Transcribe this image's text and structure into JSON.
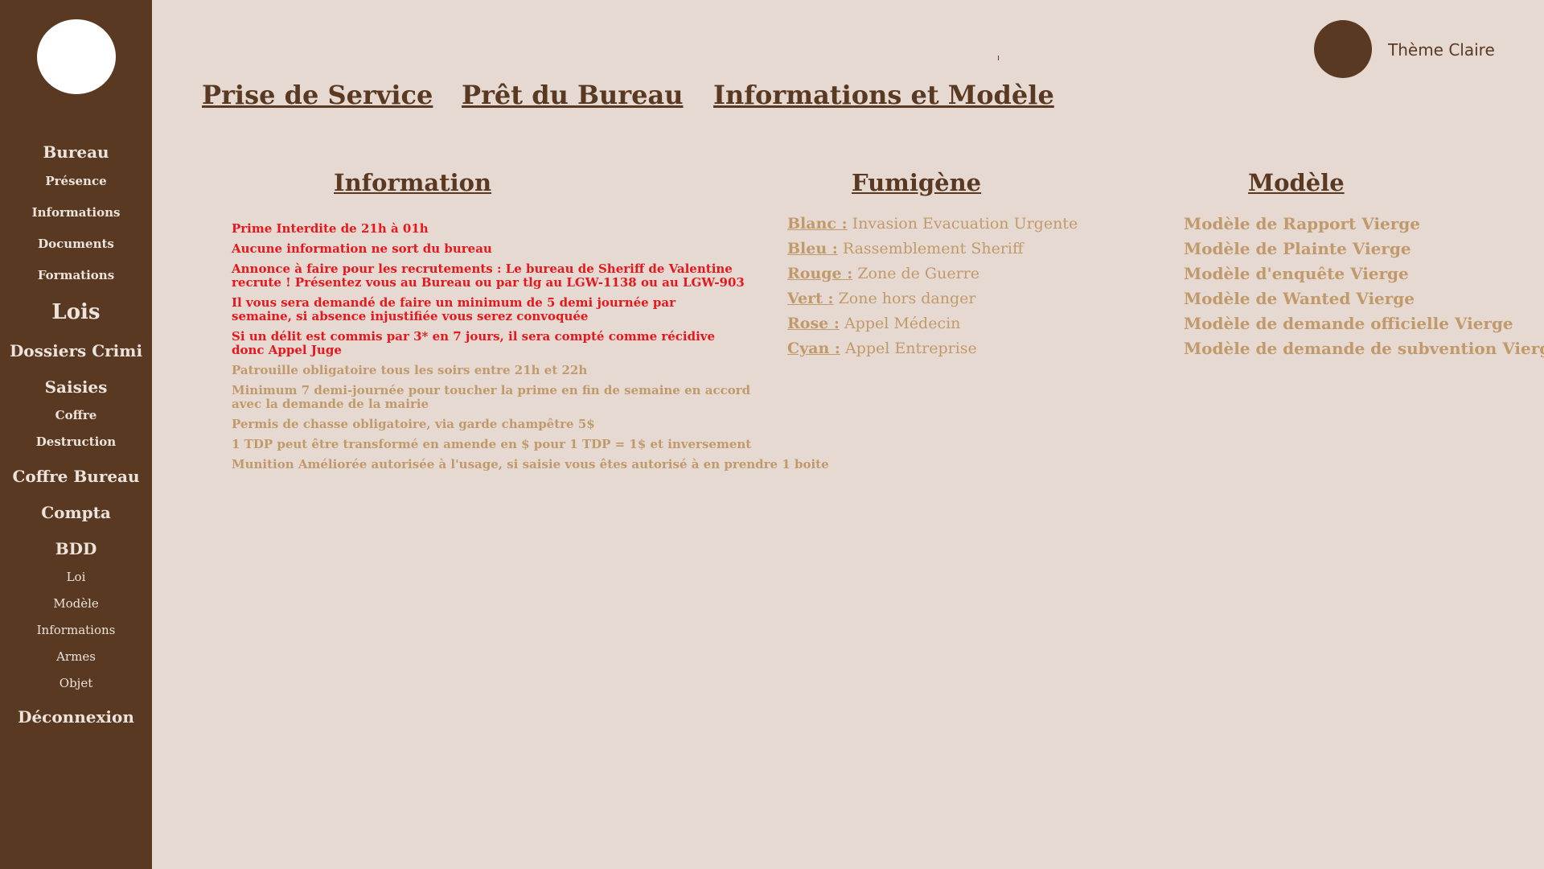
{
  "sidebar": {
    "items": [
      {
        "label": "Bureau"
      },
      {
        "label": "Présence"
      },
      {
        "label": "Informations"
      },
      {
        "label": "Documents"
      },
      {
        "label": "Formations"
      },
      {
        "label": "Lois"
      },
      {
        "label": "Dossiers Crimi"
      },
      {
        "label": "Saisies"
      },
      {
        "label": "Coffre"
      },
      {
        "label": "Destruction"
      },
      {
        "label": "Coffre Bureau"
      },
      {
        "label": "Compta"
      },
      {
        "label": "BDD"
      },
      {
        "label": "Loi"
      },
      {
        "label": "Modèle"
      },
      {
        "label": "Informations"
      },
      {
        "label": "Armes"
      },
      {
        "label": "Objet"
      },
      {
        "label": "Déconnexion"
      }
    ]
  },
  "header": {
    "theme_label": "Thème Claire",
    "tabs": [
      {
        "label": "Prise de Service"
      },
      {
        "label": "Prêt du Bureau"
      },
      {
        "label": "Informations et Modèle"
      }
    ]
  },
  "information": {
    "title": "Information",
    "rules": [
      {
        "lines": [
          "Prime Interdite de 21h à 01h"
        ]
      },
      {
        "lines": [
          "Aucune information ne sort du bureau"
        ]
      },
      {
        "lines": [
          "Annonce à faire pour les recrutements : Le bureau de Sheriff de Valentine",
          "recrute ! Présentez vous au Bureau ou par tlg au LGW-1138 ou au LGW-903"
        ]
      },
      {
        "lines": [
          "Il vous sera demandé de faire un minimum de 5 demi journée par",
          "semaine, si absence injustifiée vous serez convoquée"
        ]
      },
      {
        "lines": [
          "Si un délit est commis par 3* en 7 jours, il sera compté comme récidive",
          "donc Appel Juge"
        ]
      },
      {
        "lines": [
          "Patrouille obligatoire tous les soirs entre 21h et 22h"
        ]
      },
      {
        "lines": [
          "Minimum 7 demi-journée pour toucher la prime en fin de semaine en accord",
          "avec la demande de la mairie"
        ]
      },
      {
        "lines": [
          "Permis de chasse obligatoire, via garde champêtre 5$"
        ]
      },
      {
        "lines": [
          "1 TDP peut être transformé en amende en $ pour 1 TDP = 1$ et inversement"
        ]
      },
      {
        "lines": [
          "Munition Améliorée autorisée à l'usage, si saisie vous êtes autorisé à en prendre 1 boite"
        ]
      }
    ]
  },
  "fumigene": {
    "title": "Fumigène",
    "items": [
      {
        "color": "Blanc :",
        "meaning": "Invasion Evacuation Urgente"
      },
      {
        "color": "Bleu :",
        "meaning": "Rassemblement Sheriff"
      },
      {
        "color": "Rouge :",
        "meaning": "Zone de Guerre"
      },
      {
        "color": "Vert :",
        "meaning": "Zone hors danger"
      },
      {
        "color": "Rose :",
        "meaning": "Appel Médecin"
      },
      {
        "color": "Cyan :",
        "meaning": "Appel Entreprise"
      }
    ]
  },
  "modele": {
    "title": "Modèle",
    "items": [
      {
        "label": "Modèle de Rapport Vierge"
      },
      {
        "label": "Modèle de Plainte Vierge"
      },
      {
        "label": "Modèle d'enquête Vierge"
      },
      {
        "label": "Modèle de Wanted Vierge"
      },
      {
        "label": "Modèle de demande officielle Vierge"
      },
      {
        "label": "Modèle de demande de subvention Vierge"
      }
    ]
  },
  "colors": {
    "sidebar_bg": "#5a3922",
    "page_bg": "#e6d9d1",
    "accent_brown": "#5a3922",
    "warning_red": "#e6171d",
    "muted_tan": "#c19a6b"
  }
}
